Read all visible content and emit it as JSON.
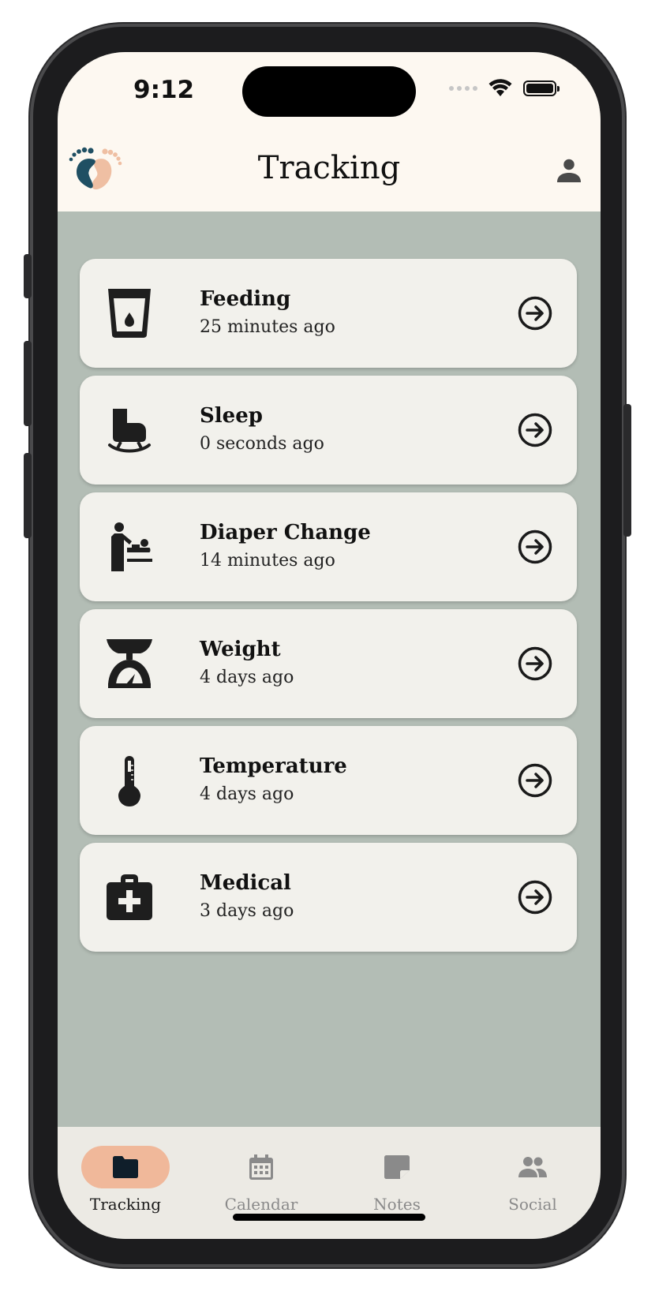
{
  "status_bar": {
    "time": "9:12",
    "icons": [
      "signal-dots-icon",
      "wifi-icon",
      "battery-icon"
    ]
  },
  "header": {
    "title": "Tracking",
    "logo_icon": "baby-feet-logo-icon",
    "profile_icon": "person-icon"
  },
  "colors": {
    "header_bg": "#fdf8f1",
    "content_bg": "#b3bdb5",
    "card_bg": "#f2f1ec",
    "nav_bg": "#eceae4",
    "active_pill": "#f0b89a",
    "logo_dark": "#1f4f63",
    "logo_light": "#efbfa3"
  },
  "tracking_items": [
    {
      "title": "Feeding",
      "subtitle": "25 minutes ago",
      "icon": "cup-icon"
    },
    {
      "title": "Sleep",
      "subtitle": "0 seconds ago",
      "icon": "crib-icon"
    },
    {
      "title": "Diaper Change",
      "subtitle": "14 minutes ago",
      "icon": "baby-changing-icon"
    },
    {
      "title": "Weight",
      "subtitle": "4 days ago",
      "icon": "scale-icon"
    },
    {
      "title": "Temperature",
      "subtitle": "4 days ago",
      "icon": "thermometer-icon"
    },
    {
      "title": "Medical",
      "subtitle": "3 days ago",
      "icon": "medical-kit-icon"
    }
  ],
  "bottom_nav": [
    {
      "label": "Tracking",
      "icon": "folder-icon",
      "active": true
    },
    {
      "label": "Calendar",
      "icon": "calendar-icon",
      "active": false
    },
    {
      "label": "Notes",
      "icon": "note-icon",
      "active": false
    },
    {
      "label": "Social",
      "icon": "people-icon",
      "active": false
    }
  ]
}
